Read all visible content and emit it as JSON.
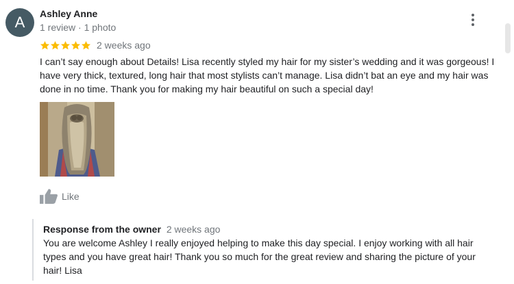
{
  "reviewer": {
    "initial": "A",
    "name": "Ashley Anne",
    "meta": "1 review · 1 photo",
    "avatar_color": "#455a64"
  },
  "review": {
    "rating": 5,
    "star_color": "#fbbc04",
    "time": "2 weeks ago",
    "text": "I can’t say enough about Details! Lisa recently styled my hair for my sister’s wedding and it was gorgeous! I have very thick, textured, long hair that most stylists can’t manage. Lisa didn’t bat an eye and my hair was done in no time. Thank you for making my hair beautiful on such a special day!",
    "photo_icon": "review-photo"
  },
  "actions": {
    "like_label": "Like",
    "like_icon": "thumbs-up-icon",
    "more_icon": "more-vert-icon"
  },
  "owner_response": {
    "title": "Response from the owner",
    "time": "2 weeks ago",
    "text": "You are welcome Ashley I really enjoyed helping to make this day special. I enjoy working with all hair types and you have great hair! Thank you so much for the great review and sharing the picture of your hair! Lisa"
  }
}
